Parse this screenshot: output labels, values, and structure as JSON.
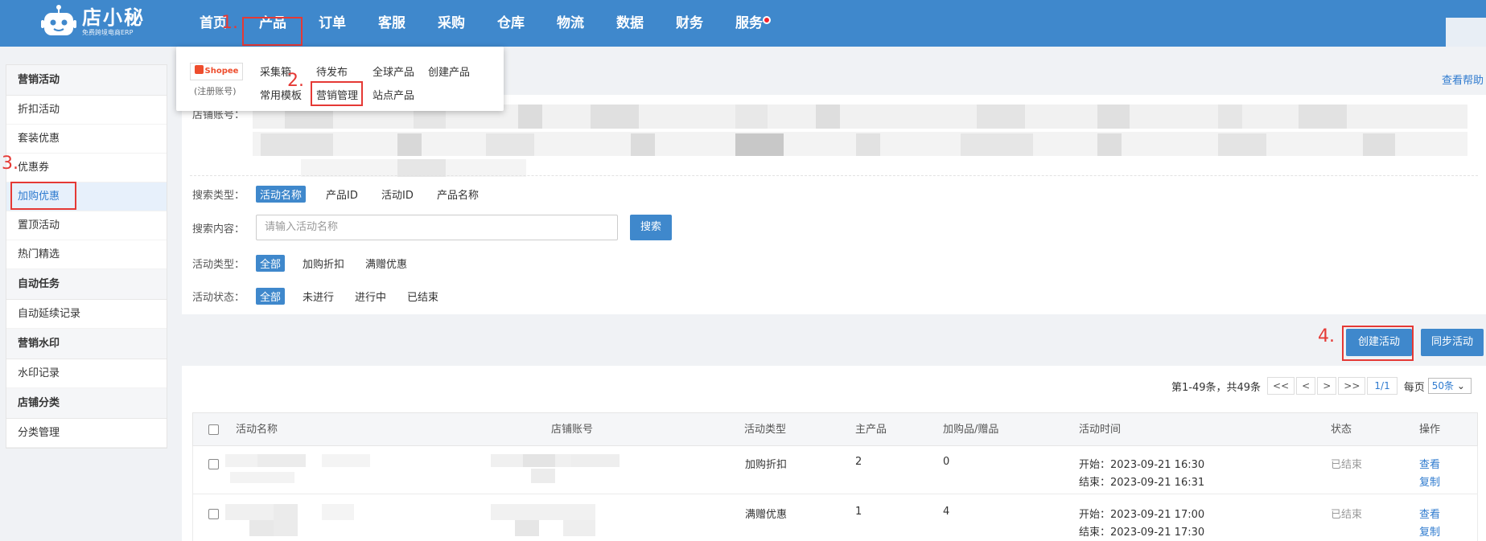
{
  "app": {
    "logo_text": "店小秘",
    "logo_sub": "免费跨境电商ERP"
  },
  "nav": {
    "items": [
      {
        "label": "首页"
      },
      {
        "label": "产品"
      },
      {
        "label": "订单"
      },
      {
        "label": "客服"
      },
      {
        "label": "采购"
      },
      {
        "label": "仓库"
      },
      {
        "label": "物流"
      },
      {
        "label": "数据"
      },
      {
        "label": "财务"
      },
      {
        "label": "服务"
      }
    ]
  },
  "steps": [
    "1.",
    "2.",
    "3.",
    "4."
  ],
  "dropdown": {
    "platform": "Shopee",
    "platform_sub": "(注册账号)",
    "links": [
      "采集箱",
      "待发布",
      "全球产品",
      "创建产品",
      "常用模板",
      "营销管理",
      "站点产品"
    ]
  },
  "sidebar": {
    "groups": [
      {
        "title": "营销活动",
        "items": [
          "折扣活动",
          "套装优惠",
          "优惠券",
          "加购优惠",
          "置顶活动",
          "热门精选"
        ]
      },
      {
        "title": "自动任务",
        "items": [
          "自动延续记录"
        ]
      },
      {
        "title": "营销水印",
        "items": [
          "水印记录"
        ]
      },
      {
        "title": "店铺分类",
        "items": [
          "分类管理"
        ]
      }
    ],
    "active_item": "加购优惠"
  },
  "filters": {
    "help_link": "查看帮助",
    "shop_account_label": "店铺账号：",
    "search_type_label": "搜索类型：",
    "search_types": [
      "活动名称",
      "产品ID",
      "活动ID",
      "产品名称"
    ],
    "search_content_label": "搜索内容：",
    "search_placeholder": "请输入活动名称",
    "search_button": "搜索",
    "activity_type_label": "活动类型：",
    "activity_types": [
      "全部",
      "加购折扣",
      "满赠优惠"
    ],
    "activity_status_label": "活动状态：",
    "activity_statuses": [
      "全部",
      "未进行",
      "进行中",
      "已结束"
    ]
  },
  "actions": {
    "create": "创建活动",
    "sync": "同步活动"
  },
  "pager": {
    "summary": "第1-49条，共49条",
    "first": "<<",
    "prev": "<",
    "next": ">",
    "last": ">>",
    "page": "1/1",
    "per_page_label": "每页",
    "per_page_value": "50条"
  },
  "table": {
    "headers": [
      "活动名称",
      "店铺账号",
      "活动类型",
      "主产品",
      "加购品/赠品",
      "活动时间",
      "状态",
      "操作"
    ],
    "rows": [
      {
        "type": "加购折扣",
        "main": "2",
        "addon": "0",
        "start": "开始：2023-09-21 16:30",
        "end": "结束：2023-09-21 16:31",
        "status": "已结束",
        "op1": "查看",
        "op2": "复制"
      },
      {
        "type": "满赠优惠",
        "main": "1",
        "addon": "4",
        "start": "开始：2023-09-21 17:00",
        "end": "结束：2023-09-21 17:30",
        "status": "已结束",
        "op1": "查看",
        "op2": "复制"
      }
    ]
  },
  "colors": {
    "brand": "#3f88cc",
    "annotation": "#e53935",
    "link": "#2f7bcf"
  }
}
